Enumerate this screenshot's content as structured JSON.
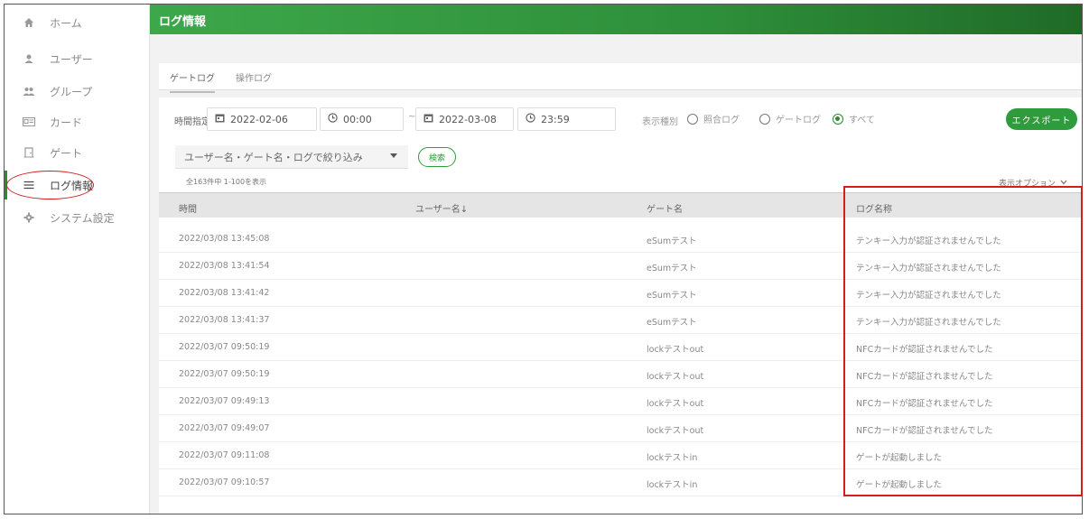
{
  "sidebar": {
    "items": [
      {
        "label": "ホーム",
        "icon": "home-icon",
        "glyph": "⌂"
      },
      {
        "label": "ユーザー",
        "icon": "user-icon",
        "glyph": "●"
      },
      {
        "label": "グループ",
        "icon": "group-icon",
        "glyph": "👥"
      },
      {
        "label": "カード",
        "icon": "card-icon",
        "glyph": "▭"
      },
      {
        "label": "ゲート",
        "icon": "gate-icon",
        "glyph": "⊓"
      },
      {
        "label": "ログ情報",
        "icon": "list-icon",
        "glyph": "☰",
        "active": true
      },
      {
        "label": "システム設定",
        "icon": "gear-icon",
        "glyph": "✿"
      }
    ]
  },
  "header": {
    "title": "ログ情報"
  },
  "tabs": [
    {
      "label": "ゲートログ",
      "active": true
    },
    {
      "label": "操作ログ",
      "active": false
    }
  ],
  "filters": {
    "time_label": "時間指定:",
    "start_date": "2022-02-06",
    "start_time": "00:00",
    "range_sep": "~",
    "end_date": "2022-03-08",
    "end_time": "23:59",
    "display_type_label": "表示種別",
    "radio_options": [
      {
        "label": "照合ログ",
        "checked": false
      },
      {
        "label": "ゲートログ",
        "checked": false
      },
      {
        "label": "すべて",
        "checked": true
      }
    ],
    "export_label": "エクスポート",
    "search_placeholder": "ユーザー名・ゲート名・ログで絞り込み",
    "search_button": "検索",
    "count_note": "全163件中 1-100を表示",
    "display_options": "表示オプション"
  },
  "table": {
    "headers": [
      "時間",
      "ユーザー名↓",
      "ゲート名",
      "ログ名称"
    ],
    "rows": [
      [
        "2022/03/08 13:45:08",
        "",
        "eSumテスト",
        "テンキー入力が認証されませんでした"
      ],
      [
        "2022/03/08 13:41:54",
        "",
        "eSumテスト",
        "テンキー入力が認証されませんでした"
      ],
      [
        "2022/03/08 13:41:42",
        "",
        "eSumテスト",
        "テンキー入力が認証されませんでした"
      ],
      [
        "2022/03/08 13:41:37",
        "",
        "eSumテスト",
        "テンキー入力が認証されませんでした"
      ],
      [
        "2022/03/07 09:50:19",
        "",
        "lockテストout",
        "NFCカードが認証されませんでした"
      ],
      [
        "2022/03/07 09:50:19",
        "",
        "lockテストout",
        "NFCカードが認証されませんでした"
      ],
      [
        "2022/03/07 09:49:13",
        "",
        "lockテストout",
        "NFCカードが認証されませんでした"
      ],
      [
        "2022/03/07 09:49:07",
        "",
        "lockテストout",
        "NFCカードが認証されませんでした"
      ],
      [
        "2022/03/07 09:11:08",
        "",
        "lockテストin",
        "ゲートが起動しました"
      ],
      [
        "2022/03/07 09:10:57",
        "",
        "lockテストin",
        "ゲートが起動しました"
      ]
    ]
  },
  "colors": {
    "accent": "#2e9b3c",
    "highlight": "#d21e1e"
  }
}
